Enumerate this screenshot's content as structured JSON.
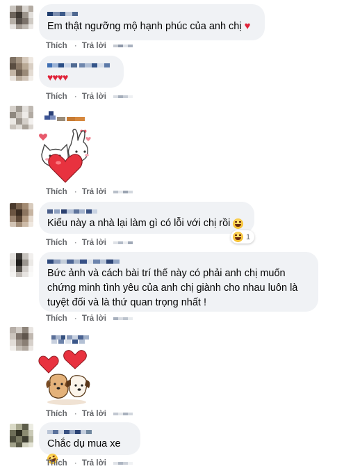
{
  "actions": {
    "like": "Thích",
    "reply": "Trả lời",
    "separator": "·"
  },
  "comments": [
    {
      "text": "Em thật ngưỡng mộ hạnh phúc của anh chị",
      "emoji": "heart-emoji"
    },
    {
      "text": "♥♥♥♥",
      "emoji": "four-hearts"
    },
    {
      "sticker": "cat-bunny-heart-sticker"
    },
    {
      "text": "Kiểu này a nhà lại làm gì có lỗi với chị rồi",
      "emoji": "laughing-face",
      "reaction_count": "1"
    },
    {
      "text": "Bức ảnh và cách bài trí thế này có phải anh chị muốn chứng minh tình yêu của anh chị giành cho nhau luôn là tuyệt đối và là thứ quan trọng nhất !"
    },
    {
      "sticker": "dogs-hearts-sticker"
    },
    {
      "text": "Chắc dụ mua xe",
      "emoji": "rofl-face"
    }
  ],
  "colors": {
    "bubble": "#f0f2f5",
    "meta": "#65676b",
    "heart": "#e0243a"
  }
}
